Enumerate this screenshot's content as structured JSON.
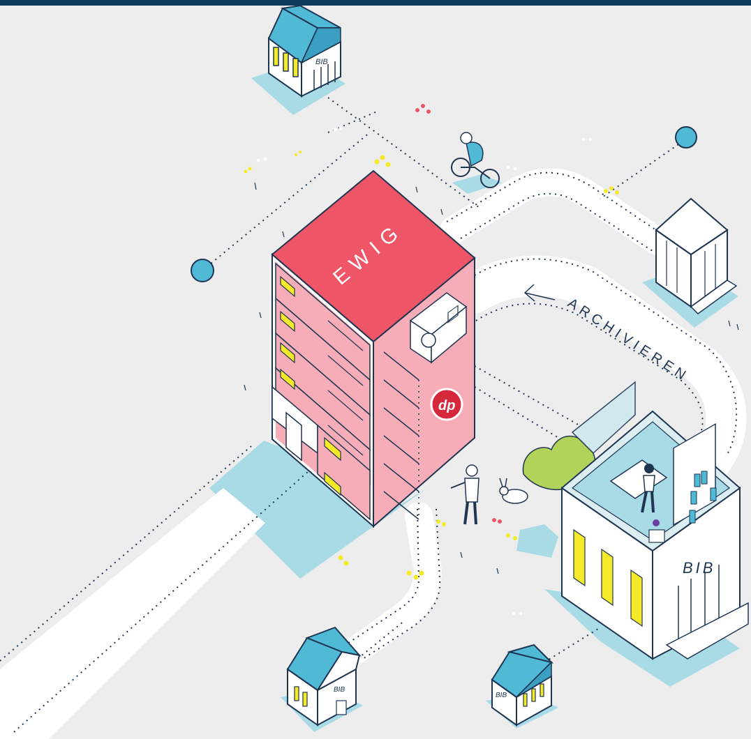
{
  "labels": {
    "main_building": "EWIG",
    "archive_arrow": "ARCHIVIEREN",
    "library_top_left": "BIB",
    "library_right": "BIB",
    "library_bottom_left": "BIB",
    "library_bottom_center": "BIB",
    "seal": "dp"
  },
  "colors": {
    "background": "#ededed",
    "top_bar": "#0e3a5c",
    "roof_red": "#ee5566",
    "wall_pink": "#f6adb7",
    "blue_shadow": "#a9dbe6",
    "teal_roof": "#4fb9d6",
    "yellow_window": "#f5ea28",
    "outline": "#1e3552",
    "bush_green": "#b2d35a",
    "seal_red": "#d5283a"
  }
}
